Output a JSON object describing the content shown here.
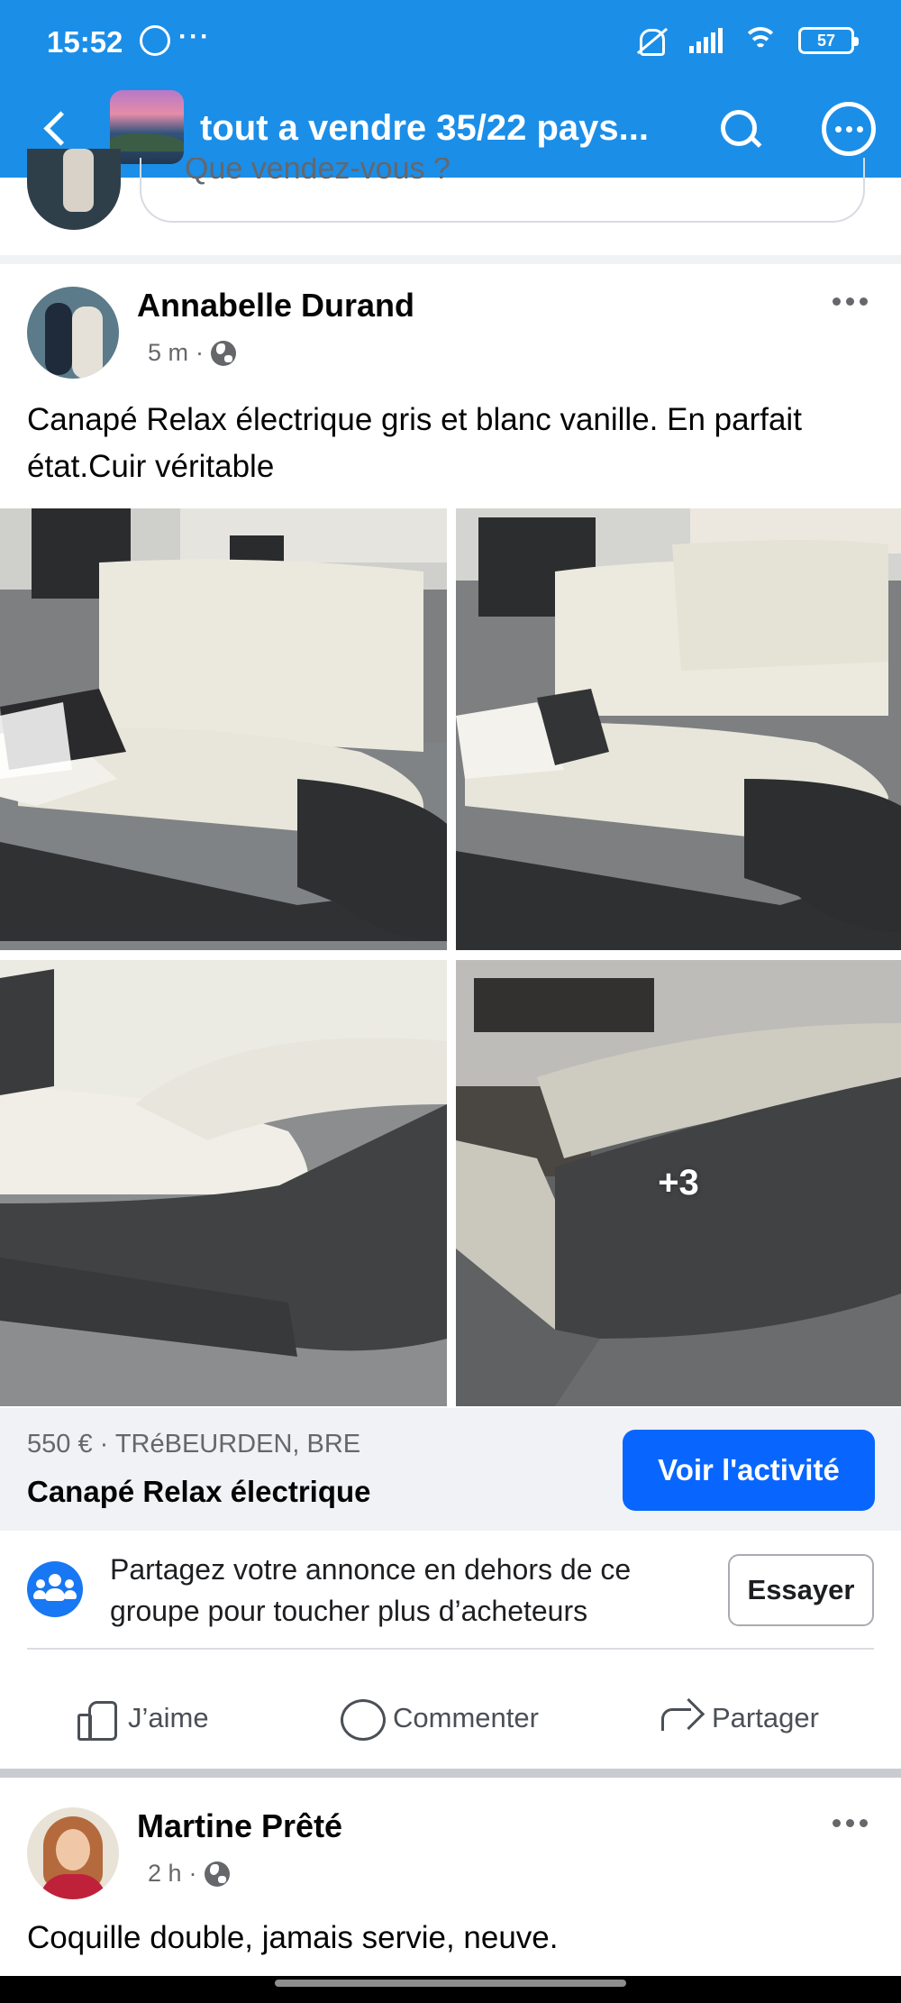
{
  "status_bar": {
    "time": "15:52",
    "notification_more": "···",
    "battery": "57"
  },
  "app_bar": {
    "title": "tout a vendre 35/22 pays..."
  },
  "composer": {
    "placeholder": "Que vendez-vous ?"
  },
  "post": {
    "author": "Annabelle Durand",
    "time": "5 m",
    "meta_sep": "·",
    "text": "Canapé Relax électrique gris et blanc vanille. En parfait état.Cuir véritable",
    "more_photos": "+3",
    "listing": {
      "price_location": "550 € · TRéBEURDEN, BRE",
      "title": "Canapé Relax électrique",
      "cta": "Voir l'activité"
    },
    "share_tip": {
      "text": "Partagez votre annonce en dehors de ce groupe pour toucher plus d’acheteurs",
      "button": "Essayer"
    },
    "actions": {
      "like": "J’aime",
      "comment": "Commenter",
      "share": "Partager"
    }
  },
  "next_post": {
    "author": "Martine Prêté",
    "time": "2 h",
    "meta_sep": "·",
    "text": "Coquille double, jamais servie, neuve."
  },
  "colors": {
    "app_bar": "#1b8ee8",
    "primary_button": "#0866ff",
    "listing_bg": "#f0f2f5",
    "secondary_text": "#65676b"
  },
  "icons": [
    "whatsapp-icon",
    "mute-icon",
    "signal-icon",
    "wifi-icon",
    "battery-icon",
    "back-icon",
    "search-icon",
    "more-icon",
    "globe-icon",
    "group-icon",
    "like-icon",
    "comment-icon",
    "share-icon"
  ]
}
